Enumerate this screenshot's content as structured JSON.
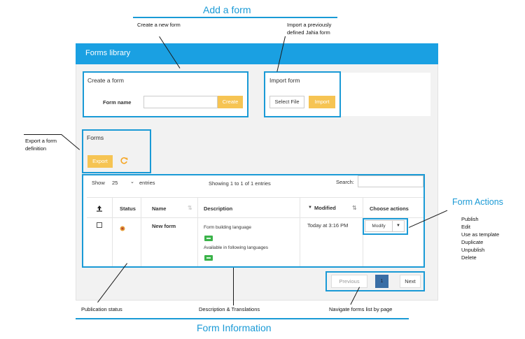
{
  "annotations": {
    "add_form": "Add a form",
    "create_new_form": "Create a new form",
    "import_form": "Import a previously defined Jahia form",
    "export_form": "Export a form definition",
    "form_actions_title": "Form Actions",
    "form_actions_list": [
      "Publish",
      "Edit",
      "Use as template",
      "Duplicate",
      "Unpublish",
      "Delete"
    ],
    "publication_status": "Publication status",
    "description_translations": "Description & Translations",
    "navigate_pages": "Navigate forms list by page",
    "form_information": "Form Information"
  },
  "app": {
    "title": "Forms library"
  },
  "create_form": {
    "title": "Create a form",
    "name_label": "Form name",
    "name_value": "",
    "create_button": "Create"
  },
  "import_form": {
    "title": "Import form",
    "select_file_button": "Select File",
    "import_button": "Import"
  },
  "forms_section": {
    "title": "Forms",
    "export_button": "Export"
  },
  "table": {
    "show_label": "Show",
    "entries_value": "25",
    "entries_label": "entries",
    "info": "Showing 1 to 1 of 1 entries",
    "search_label": "Search:",
    "search_value": "",
    "columns": {
      "status": "Status",
      "name": "Name",
      "description": "Description",
      "modified": "Modified",
      "actions": "Choose actions"
    },
    "rows": [
      {
        "name": "New form",
        "desc_line1": "Form building language",
        "desc_line2": "Available in following languages",
        "modified": "Today at 3:16 PM",
        "action_button": "Modify"
      }
    ]
  },
  "pagination": {
    "previous": "Previous",
    "current_page": "1",
    "next": "Next"
  },
  "colors": {
    "accent_blue": "#1aa0e2",
    "button_yellow": "#f6c453",
    "badge_green": "#3bb34a",
    "page_active": "#3a6ea5"
  }
}
